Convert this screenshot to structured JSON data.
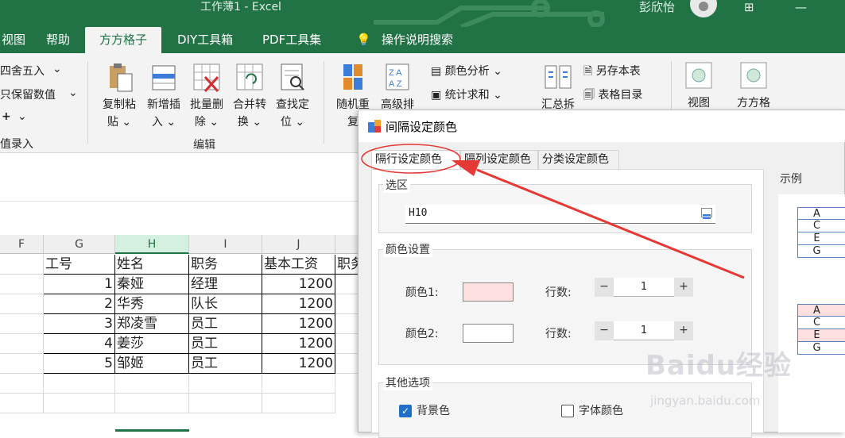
{
  "window": {
    "title": "工作薄1  -  Excel",
    "user": "彭欣怡"
  },
  "ribbon_tabs": [
    "视图",
    "帮助",
    "方方格子",
    "DIY工具箱",
    "PDF工具集",
    "操作说明搜索"
  ],
  "ribbon": {
    "left": {
      "round": "四舍五入",
      "round_arrow": "⌄",
      "keep": "只保留数值",
      "keep_arrow": "⌄",
      "plus": "+",
      "plus_arrow": "⌄",
      "input": "值录入"
    },
    "edit_buttons": [
      {
        "l1": "复制粘",
        "l2": "贴 ⌄"
      },
      {
        "l1": "新增插",
        "l2": "入 ⌄"
      },
      {
        "l1": "批量删",
        "l2": "除 ⌄"
      },
      {
        "l1": "合并转",
        "l2": "换 ⌄"
      },
      {
        "l1": "查找定",
        "l2": "位 ⌄"
      }
    ],
    "edit_group": "编辑",
    "random": {
      "l1": "随机重",
      "l2": "复"
    },
    "sort": {
      "l1": "高级排"
    },
    "color_analysis": "颜色分析 ⌄",
    "stat_sum": "统计求和 ⌄",
    "summary": "汇总拆",
    "save_sheet": "另存本表",
    "sheet_dir": "表格目录",
    "view": "视图",
    "ffgz": "方方格"
  },
  "sheet": {
    "columns": [
      "F",
      "G",
      "H",
      "I",
      "J"
    ],
    "selected_col": "H",
    "header": [
      "工号",
      "姓名",
      "职务",
      "基本工资",
      "职务"
    ],
    "rows": [
      [
        "1",
        "秦娅",
        "经理",
        "1200"
      ],
      [
        "2",
        "华秀",
        "队长",
        "1200"
      ],
      [
        "3",
        "郑凌雪",
        "员工",
        "1200"
      ],
      [
        "4",
        "姜莎",
        "员工",
        "1200"
      ],
      [
        "5",
        "邹姬",
        "员工",
        "1200"
      ]
    ]
  },
  "dialog": {
    "title": "间隔设定颜色",
    "tabs": [
      "隔行设定颜色",
      "隔列设定颜色",
      "分类设定颜色"
    ],
    "selection_group": "选区",
    "range_value": "H10",
    "color_group": "颜色设置",
    "color1_label": "颜色1:",
    "color2_label": "颜色2:",
    "rows_label": "行数:",
    "rows1": "1",
    "rows2": "1",
    "minus": "−",
    "plus": "+",
    "color1": "#fde0df",
    "color2": "#ffffff",
    "other_group": "其他选项",
    "bg_color_label": "背景色",
    "bg_checked": true,
    "font_color_label": "字体颜色",
    "example_label": "示例",
    "example_top": [
      "A",
      "C",
      "E",
      "G"
    ],
    "example_bottom": [
      "A",
      "C",
      "E",
      "G"
    ],
    "example_highlight": "#fde0df"
  },
  "watermark": {
    "brand": "Baidu经验",
    "url": "jingyan.baidu.com"
  },
  "colors": {
    "excel_green": "#217346",
    "annotation_red": "#e53935"
  }
}
